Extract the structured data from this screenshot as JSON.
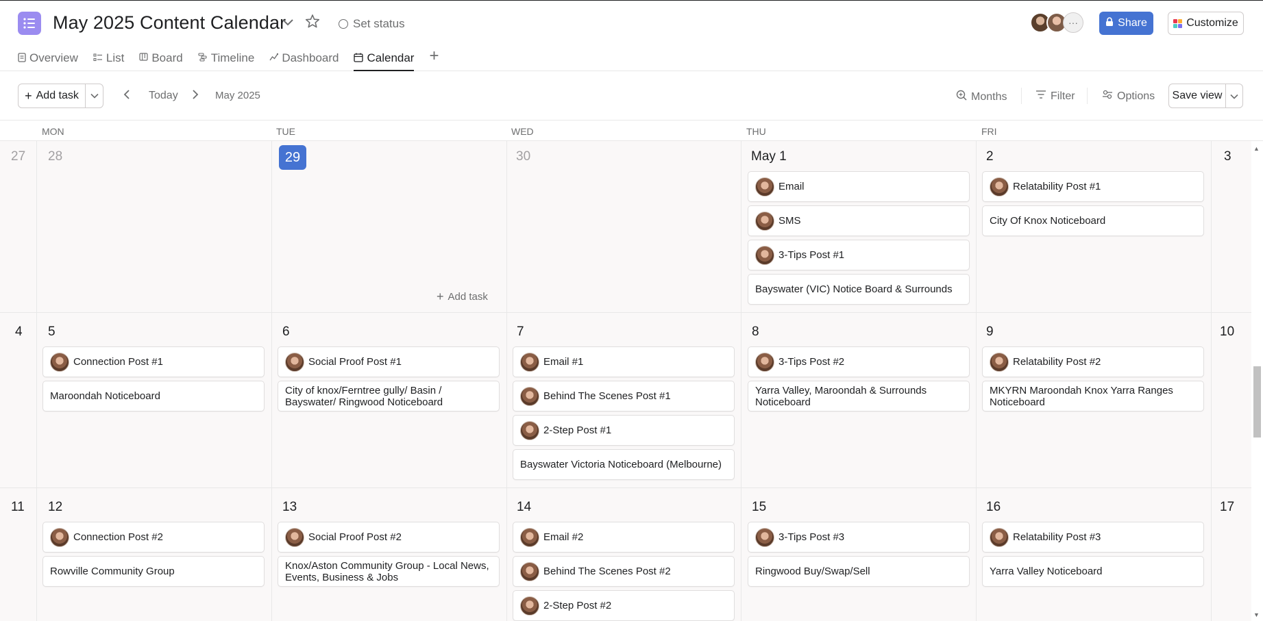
{
  "header": {
    "title": "May 2025 Content Calendar",
    "set_status": "Set status",
    "share_label": "Share",
    "customize_label": "Customize",
    "more_avatars": "···"
  },
  "tabs": [
    {
      "label": "Overview",
      "icon": "overview-icon"
    },
    {
      "label": "List",
      "icon": "list-icon"
    },
    {
      "label": "Board",
      "icon": "board-icon"
    },
    {
      "label": "Timeline",
      "icon": "timeline-icon"
    },
    {
      "label": "Dashboard",
      "icon": "dashboard-icon"
    },
    {
      "label": "Calendar",
      "icon": "calendar-icon",
      "active": true
    }
  ],
  "toolbar": {
    "add_task": "Add task",
    "today": "Today",
    "current_month": "May 2025",
    "months": "Months",
    "filter": "Filter",
    "options": "Options",
    "save_view": "Save view"
  },
  "day_headers": [
    "MON",
    "TUE",
    "WED",
    "THU",
    "FRI"
  ],
  "weeks": [
    {
      "sun": "27",
      "sat": "3",
      "days": [
        {
          "date": "28",
          "dim": true,
          "tasks": []
        },
        {
          "date": "29",
          "today": true,
          "tasks": [],
          "add_task": "Add task"
        },
        {
          "date": "30",
          "dim": true,
          "tasks": []
        },
        {
          "date": "May 1",
          "tasks": [
            {
              "title": "Email",
              "avatar": true
            },
            {
              "title": "SMS",
              "avatar": true
            },
            {
              "title": "3-Tips Post #1",
              "avatar": true
            },
            {
              "title": "Bayswater (VIC) Notice Board & Surrounds",
              "avatar": false
            }
          ]
        },
        {
          "date": "2",
          "tasks": [
            {
              "title": "Relatability Post #1",
              "avatar": true
            },
            {
              "title": "City Of Knox Noticeboard",
              "avatar": false
            }
          ]
        }
      ]
    },
    {
      "sun": "4",
      "sat": "10",
      "days": [
        {
          "date": "5",
          "tasks": [
            {
              "title": "Connection Post #1",
              "avatar": true
            },
            {
              "title": "Maroondah Noticeboard",
              "avatar": false
            }
          ]
        },
        {
          "date": "6",
          "tasks": [
            {
              "title": "Social Proof Post #1",
              "avatar": true
            },
            {
              "title": "City of knox/Ferntree gully/ Basin / Bayswater/ Ringwood Noticeboard",
              "avatar": false,
              "tall": true
            }
          ]
        },
        {
          "date": "7",
          "tasks": [
            {
              "title": "Email #1",
              "avatar": true
            },
            {
              "title": "Behind The Scenes Post #1",
              "avatar": true
            },
            {
              "title": "2-Step Post #1",
              "avatar": true
            },
            {
              "title": "Bayswater Victoria Noticeboard (Melbourne)",
              "avatar": false
            }
          ]
        },
        {
          "date": "8",
          "tasks": [
            {
              "title": "3-Tips Post #2",
              "avatar": true
            },
            {
              "title": "Yarra Valley, Maroondah & Surrounds Noticeboard",
              "avatar": false,
              "tall": true
            }
          ]
        },
        {
          "date": "9",
          "tasks": [
            {
              "title": "Relatability Post #2",
              "avatar": true
            },
            {
              "title": "MKYRN Maroondah Knox Yarra Ranges Noticeboard",
              "avatar": false,
              "tall": true
            }
          ]
        }
      ]
    },
    {
      "sun": "11",
      "sat": "17",
      "days": [
        {
          "date": "12",
          "tasks": [
            {
              "title": "Connection Post #2",
              "avatar": true
            },
            {
              "title": "Rowville Community Group",
              "avatar": false
            }
          ]
        },
        {
          "date": "13",
          "tasks": [
            {
              "title": "Social Proof Post #2",
              "avatar": true
            },
            {
              "title": "Knox/Aston Community Group - Local News, Events, Business & Jobs",
              "avatar": false,
              "tall": true
            }
          ]
        },
        {
          "date": "14",
          "tasks": [
            {
              "title": "Email #2",
              "avatar": true
            },
            {
              "title": "Behind The Scenes Post #2",
              "avatar": true
            },
            {
              "title": "2-Step Post #2",
              "avatar": true
            }
          ]
        },
        {
          "date": "15",
          "tasks": [
            {
              "title": "3-Tips Post #3",
              "avatar": true
            },
            {
              "title": "Ringwood Buy/Swap/Sell",
              "avatar": false
            }
          ]
        },
        {
          "date": "16",
          "tasks": [
            {
              "title": "Relatability Post #3",
              "avatar": true
            },
            {
              "title": "Yarra Valley Noticeboard",
              "avatar": false
            }
          ]
        }
      ]
    }
  ],
  "colors": {
    "accent": "#4573d2",
    "project_icon": "#9b8cf0"
  }
}
